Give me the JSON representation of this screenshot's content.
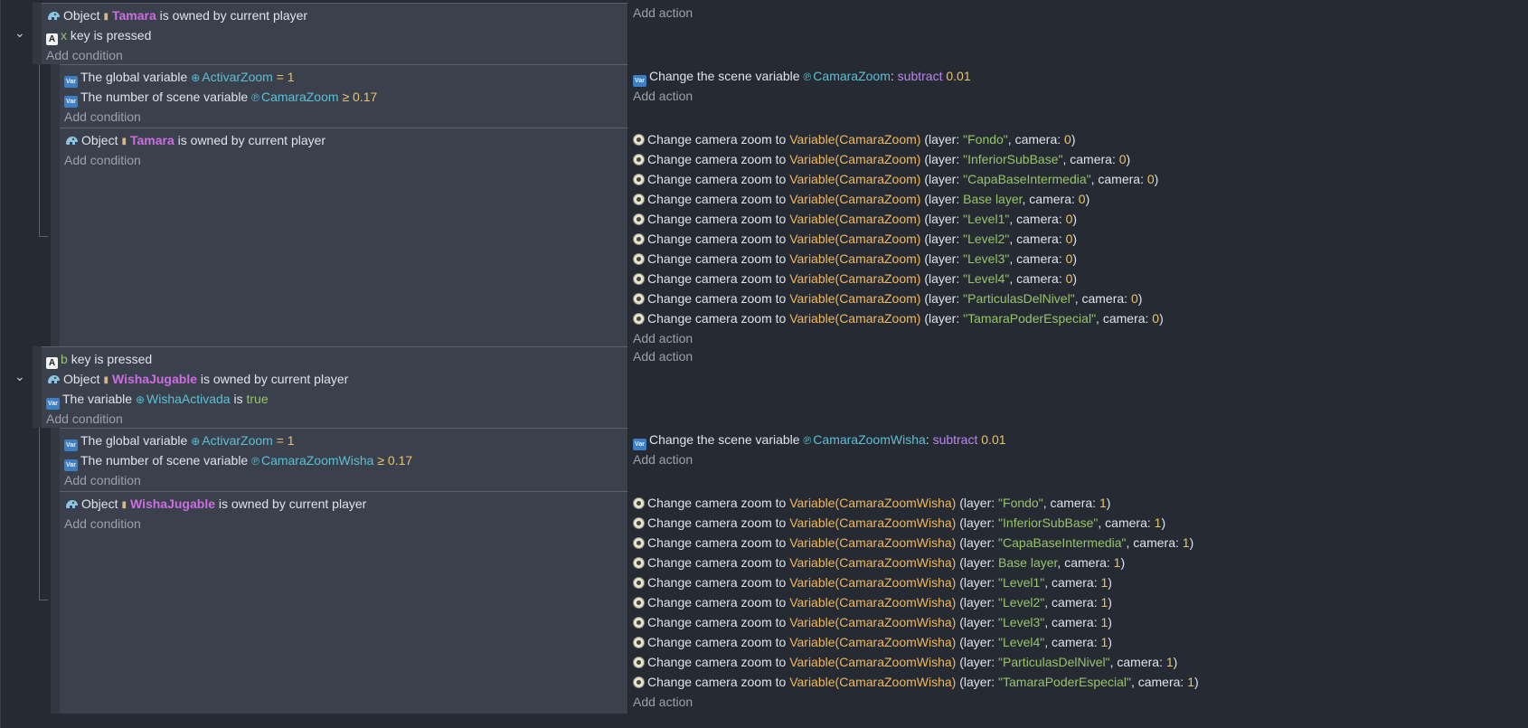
{
  "events": [
    {
      "conditions": [
        {
          "type": "object",
          "object": "Tamara",
          "text": "is owned by current player"
        },
        {
          "type": "key",
          "key": "x",
          "text": "key is pressed"
        }
      ],
      "add_condition": "Add condition",
      "add_action": "Add action",
      "subs": [
        {
          "conditions": [
            {
              "type": "global",
              "text": "The global variable",
              "var": "ActivarZoom",
              "op": "=",
              "value": "1"
            },
            {
              "type": "scene",
              "text": "The number of scene variable",
              "var": "CamaraZoom",
              "op": "≥",
              "value": "0.17"
            }
          ],
          "add_condition": "Add condition",
          "actions": [
            {
              "text": "Change the scene variable",
              "var": "CamaraZoom",
              "op": "subtract",
              "value": "0.01"
            }
          ],
          "add_action": "Add action"
        },
        {
          "conditions": [
            {
              "type": "object",
              "object": "Tamara",
              "text": "is owned by current player"
            }
          ],
          "add_condition": "Add condition",
          "actions": [
            {
              "layer": "\"Fondo\"",
              "camera": "0"
            },
            {
              "layer": "\"InferiorSubBase\"",
              "camera": "0"
            },
            {
              "layer": "\"CapaBaseIntermedia\"",
              "camera": "0"
            },
            {
              "layer": "Base layer",
              "camera": "0"
            },
            {
              "layer": "\"Level1\"",
              "camera": "0"
            },
            {
              "layer": "\"Level2\"",
              "camera": "0"
            },
            {
              "layer": "\"Level3\"",
              "camera": "0"
            },
            {
              "layer": "\"Level4\"",
              "camera": "0"
            },
            {
              "layer": "\"ParticulasDelNivel\"",
              "camera": "0"
            },
            {
              "layer": "\"TamaraPoderEspecial\"",
              "camera": "0"
            }
          ],
          "zoom_expr": "Variable(CamaraZoom)",
          "add_action": "Add action"
        }
      ]
    },
    {
      "conditions": [
        {
          "type": "key",
          "key": "b",
          "text": "key is pressed"
        },
        {
          "type": "object",
          "object": "WishaJugable",
          "text": "is owned by current player"
        },
        {
          "type": "variable",
          "text": "The variable",
          "var": "WishaActivada",
          "suffix": "is",
          "value": "true"
        }
      ],
      "add_condition": "Add condition",
      "add_action": "Add action",
      "subs": [
        {
          "conditions": [
            {
              "type": "global",
              "text": "The global variable",
              "var": "ActivarZoom",
              "op": "=",
              "value": "1"
            },
            {
              "type": "scene",
              "text": "The number of scene variable",
              "var": "CamaraZoomWisha",
              "op": "≥",
              "value": "0.17"
            }
          ],
          "add_condition": "Add condition",
          "actions": [
            {
              "text": "Change the scene variable",
              "var": "CamaraZoomWisha",
              "op": "subtract",
              "value": "0.01"
            }
          ],
          "add_action": "Add action"
        },
        {
          "conditions": [
            {
              "type": "object",
              "object": "WishaJugable",
              "text": "is owned by current player"
            }
          ],
          "add_condition": "Add condition",
          "actions": [
            {
              "layer": "\"Fondo\"",
              "camera": "1"
            },
            {
              "layer": "\"InferiorSubBase\"",
              "camera": "1"
            },
            {
              "layer": "\"CapaBaseIntermedia\"",
              "camera": "1"
            },
            {
              "layer": "Base layer",
              "camera": "1"
            },
            {
              "layer": "\"Level1\"",
              "camera": "1"
            },
            {
              "layer": "\"Level2\"",
              "camera": "1"
            },
            {
              "layer": "\"Level3\"",
              "camera": "1"
            },
            {
              "layer": "\"Level4\"",
              "camera": "1"
            },
            {
              "layer": "\"ParticulasDelNivel\"",
              "camera": "1"
            },
            {
              "layer": "\"TamaraPoderEspecial\"",
              "camera": "1"
            }
          ],
          "zoom_expr": "Variable(CamaraZoomWisha)",
          "add_action": "Add action"
        }
      ]
    }
  ],
  "labels": {
    "object_prefix": "Object",
    "zoom_action": "Change camera zoom to",
    "layer_label": "layer",
    "camera_label": "camera",
    "var_icon": "Var",
    "key_icon": "A"
  },
  "colors": {
    "background": "#262a33",
    "condition_bg": "#3b404d",
    "object": "#cc6ee0",
    "variable": "#5cc0d4",
    "number": "#e9c46a",
    "string": "#96c46a",
    "operator": "#bb86ee",
    "expression": "#f0b85c"
  }
}
